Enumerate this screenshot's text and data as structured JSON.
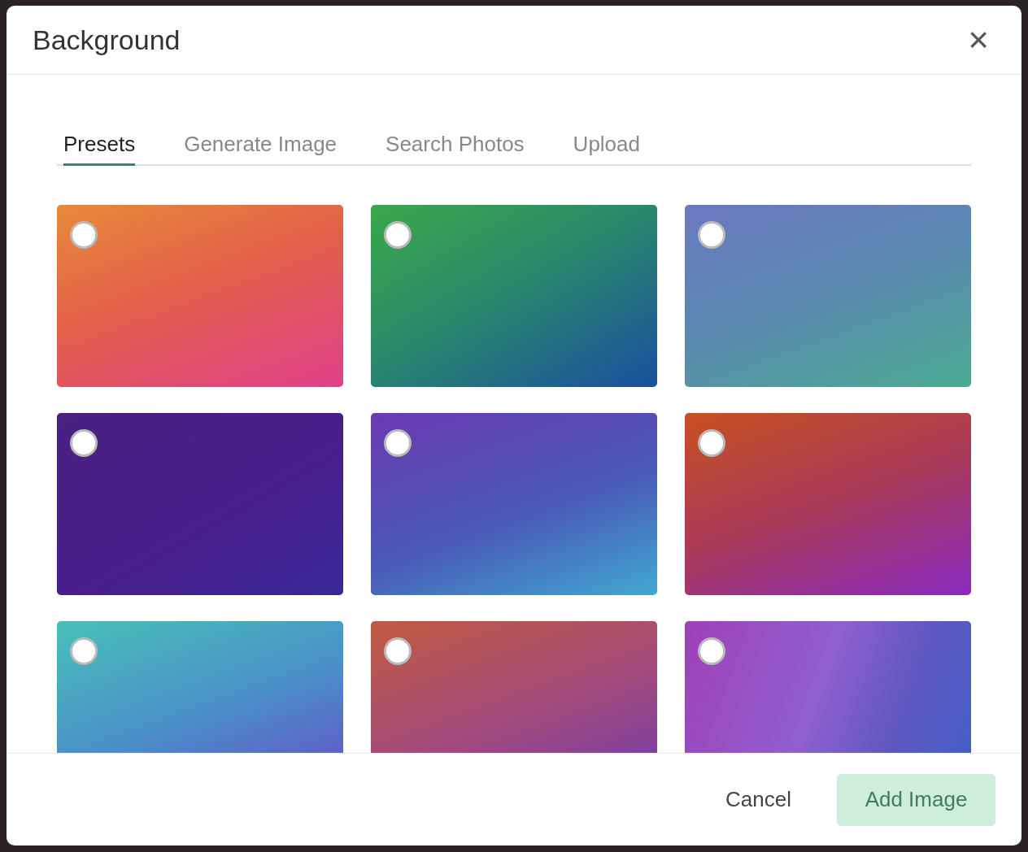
{
  "dialog": {
    "title": "Background",
    "close": "×"
  },
  "tabs": [
    {
      "label": "Presets",
      "selected": true
    },
    {
      "label": "Generate Image",
      "selected": false
    },
    {
      "label": "Search Photos",
      "selected": false
    },
    {
      "label": "Upload",
      "selected": false
    }
  ],
  "presets": [
    {
      "selected": false
    },
    {
      "selected": false
    },
    {
      "selected": false
    },
    {
      "selected": false
    },
    {
      "selected": false
    },
    {
      "selected": false
    },
    {
      "selected": false
    },
    {
      "selected": false
    },
    {
      "selected": false
    }
  ],
  "footer": {
    "cancel": "Cancel",
    "confirm": {
      "label": "Add Image",
      "disabled": true
    }
  }
}
